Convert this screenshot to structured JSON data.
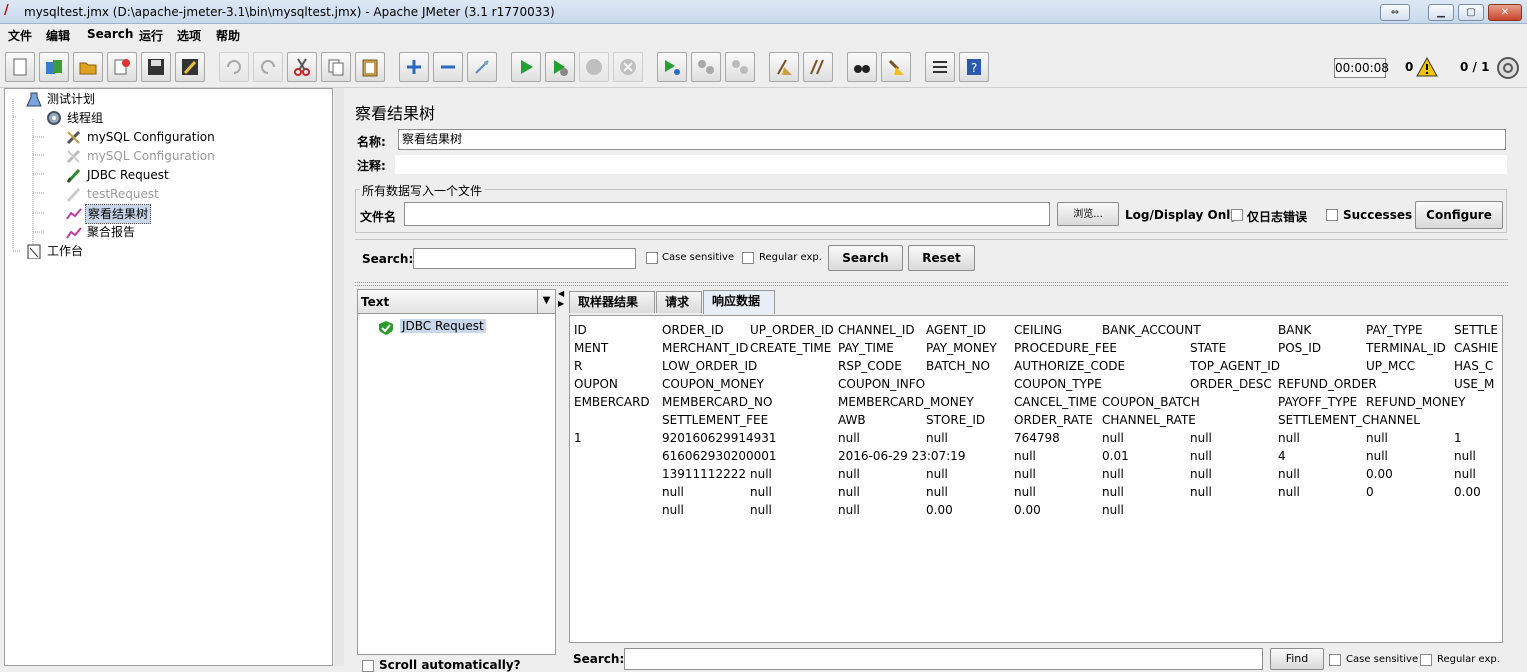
{
  "window": {
    "title": "mysqltest.jmx (D:\\apache-jmeter-3.1\\bin\\mysqltest.jmx) - Apache JMeter (3.1 r1770033)"
  },
  "menu": [
    "文件",
    "编辑",
    "Search",
    "运行",
    "选项",
    "帮助"
  ],
  "status": {
    "timer": "00:00:08",
    "warnings": "0",
    "threads": "0 / 1"
  },
  "tree": [
    {
      "label": "测试计划",
      "icon": "flask-icon"
    },
    {
      "label": "线程组",
      "icon": "gear-icon"
    },
    {
      "label": "mySQL Configuration",
      "icon": "wrench-icon"
    },
    {
      "label": "mySQL Configuration",
      "icon": "wrench-icon"
    },
    {
      "label": "JDBC Request",
      "icon": "pen-icon"
    },
    {
      "label": "testRequest",
      "icon": "pen-icon"
    },
    {
      "label": "察看结果树",
      "icon": "graph-icon"
    },
    {
      "label": "聚合报告",
      "icon": "graph-icon"
    },
    {
      "label": "工作台",
      "icon": "clipboard-icon"
    }
  ],
  "panel": {
    "title": "察看结果树",
    "name_label": "名称:",
    "name_value": "察看结果树",
    "comment_label": "注释:",
    "file_legend": "所有数据写入一个文件",
    "file_label": "文件名",
    "browse_label": "浏览...",
    "log_label": "Log/Display Only:",
    "errors_label": "仅日志错误",
    "successes_label": "Successes",
    "configure_label": "Configure",
    "search_label": "Search:",
    "case_label": "Case sensitive",
    "regex_label": "Regular exp.",
    "search_btn": "Search",
    "reset_btn": "Reset",
    "renderer": "Text",
    "result_item": "JDBC Request",
    "scroll_label": "Scroll automatically?",
    "tabs": [
      "取样器结果",
      "请求",
      "响应数据"
    ],
    "find_label": "Search:",
    "find_btn": "Find",
    "find_case": "Case sensitive",
    "find_regex": "Regular exp."
  },
  "response_rows": [
    [
      "ID",
      "ORDER_ID",
      "UP_ORDER_ID",
      "CHANNEL_ID",
      "AGENT_ID",
      "CEILING",
      "BANK_ACCOUNT",
      "",
      "BANK",
      "PAY_TYPE",
      "SETTLE"
    ],
    [
      "MENT",
      "MERCHANT_ID",
      "CREATE_TIME",
      "PAY_TIME",
      "PAY_MONEY",
      "PROCEDURE_FEE",
      "",
      "STATE",
      "POS_ID",
      "TERMINAL_ID",
      "CASHIE"
    ],
    [
      "R",
      "LOW_ORDER_ID",
      "",
      "RSP_CODE",
      "BATCH_NO",
      "AUTHORIZE_CODE",
      "",
      "TOP_AGENT_ID",
      "",
      "UP_MCC",
      "HAS_C"
    ],
    [
      "OUPON",
      "COUPON_MONEY",
      "",
      "COUPON_INFO",
      "",
      "COUPON_TYPE",
      "",
      "ORDER_DESC",
      "REFUND_ORDER",
      "",
      "USE_M"
    ],
    [
      "EMBERCARD",
      "MEMBERCARD_NO",
      "",
      "MEMBERCARD_MONEY",
      "",
      "CANCEL_TIME",
      "COUPON_BATCH",
      "",
      "PAYOFF_TYPE",
      "REFUND_MONEY",
      ""
    ],
    [
      "",
      "SETTLEMENT_FEE",
      "",
      "AWB",
      "STORE_ID",
      "ORDER_RATE",
      "CHANNEL_RATE",
      "",
      "SETTLEMENT_CHANNEL",
      "",
      ""
    ],
    [
      "1",
      "920160629914931",
      "",
      "null",
      "null",
      "764798",
      "null",
      "null",
      "null",
      "null",
      "1"
    ],
    [
      "",
      "616062930200001",
      "",
      "2016-06-29 23:07:19",
      "",
      "null",
      "0.01",
      "null",
      "4",
      "null",
      "null"
    ],
    [
      "",
      "13911112222",
      "null",
      "null",
      "null",
      "null",
      "null",
      "null",
      "null",
      "0.00",
      "null"
    ],
    [
      "",
      "null",
      "null",
      "null",
      "null",
      "null",
      "null",
      "null",
      "null",
      "0",
      "0.00"
    ],
    [
      "",
      "null",
      "null",
      "null",
      "0.00",
      "0.00",
      "null",
      "",
      "",
      "",
      ""
    ]
  ]
}
